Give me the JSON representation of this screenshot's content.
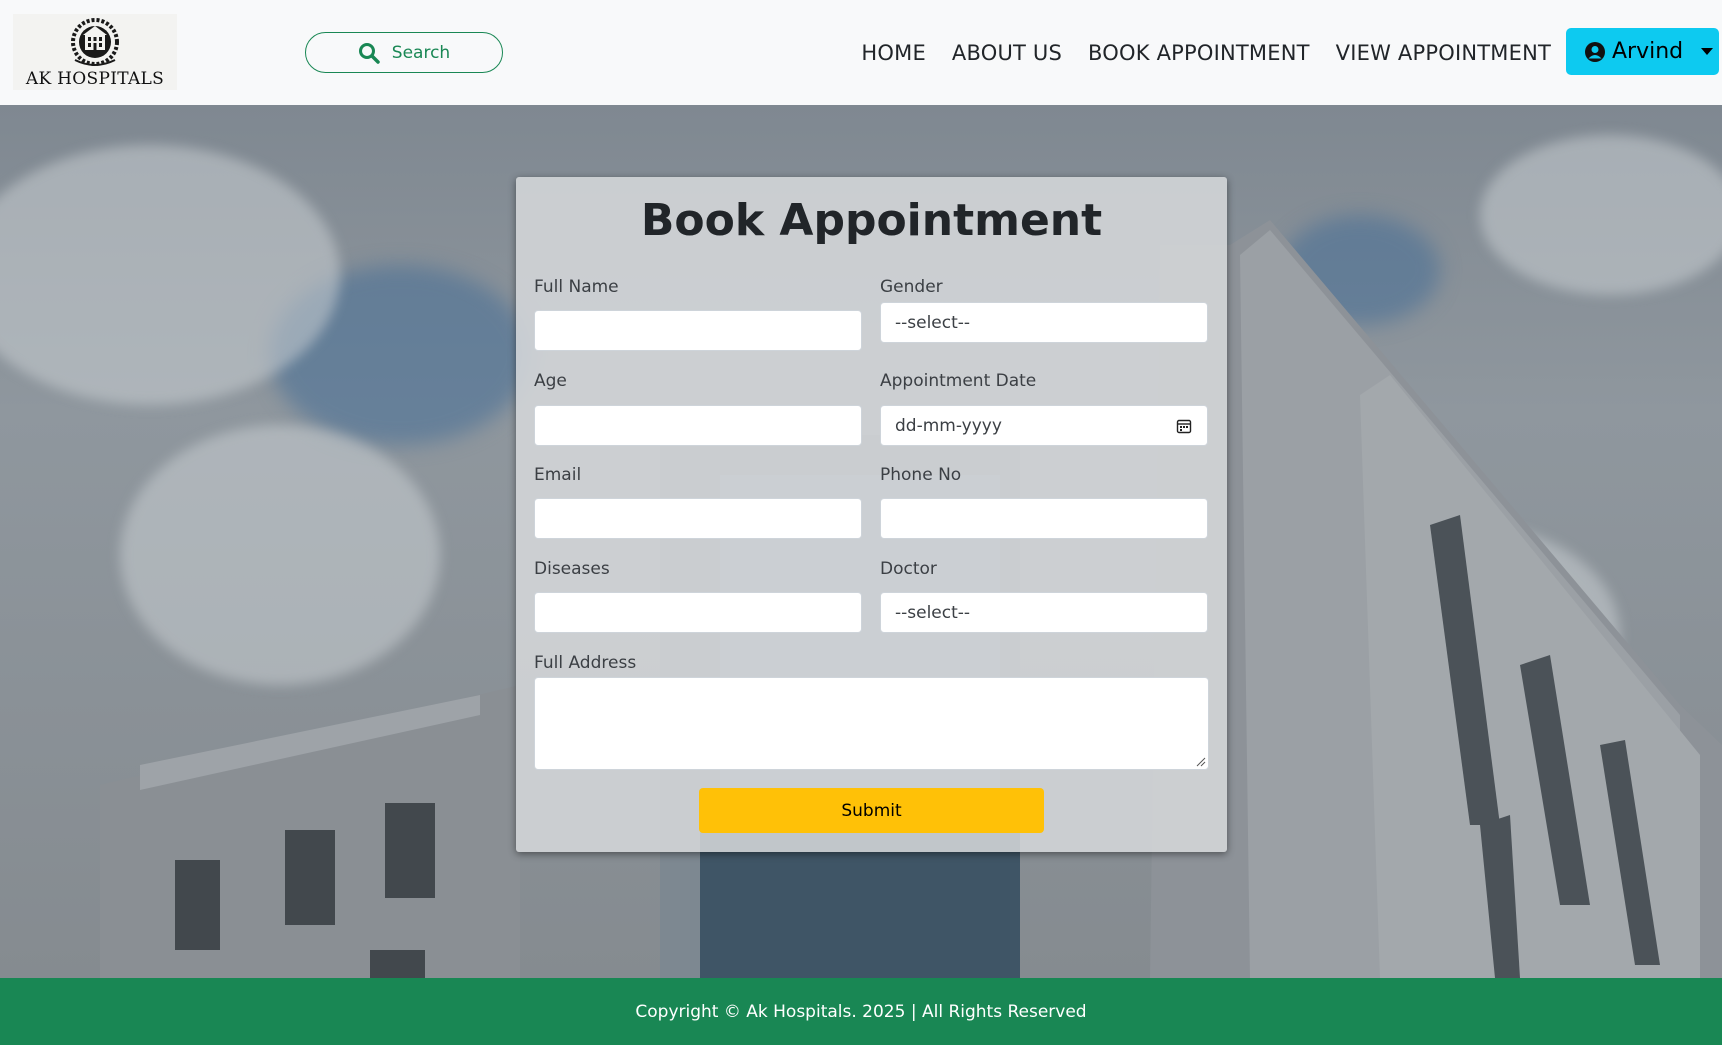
{
  "brand": {
    "name": "AK HOSPITALS",
    "logo_icon": "hospital-crest-icon"
  },
  "search": {
    "label": "Search",
    "icon": "search-icon"
  },
  "nav": {
    "home": "HOME",
    "about": "ABOUT US",
    "book": "BOOK APPOINTMENT",
    "view": "VIEW APPOINTMENT"
  },
  "user": {
    "name": "Arvind",
    "icon": "user-circle-icon"
  },
  "form": {
    "title": "Book Appointment",
    "full_name_label": "Full Name",
    "full_name_value": "",
    "gender_label": "Gender",
    "gender_value": "--select--",
    "age_label": "Age",
    "age_value": "",
    "date_label": "Appointment Date",
    "date_placeholder": "dd-mm-yyyy",
    "email_label": "Email",
    "email_value": "",
    "phone_label": "Phone No",
    "phone_value": "",
    "diseases_label": "Diseases",
    "diseases_value": "",
    "doctor_label": "Doctor",
    "doctor_value": "--select--",
    "address_label": "Full Address",
    "address_value": "",
    "submit_label": "Submit"
  },
  "footer": {
    "text": "Copyright © Ak Hospitals. 2025 | All Rights Reserved"
  },
  "colors": {
    "navbar_bg": "#f8f9fa",
    "search_accent": "#198754",
    "user_button": "#0dcaf0",
    "submit_button": "#ffc107",
    "footer_bg": "#198754"
  }
}
